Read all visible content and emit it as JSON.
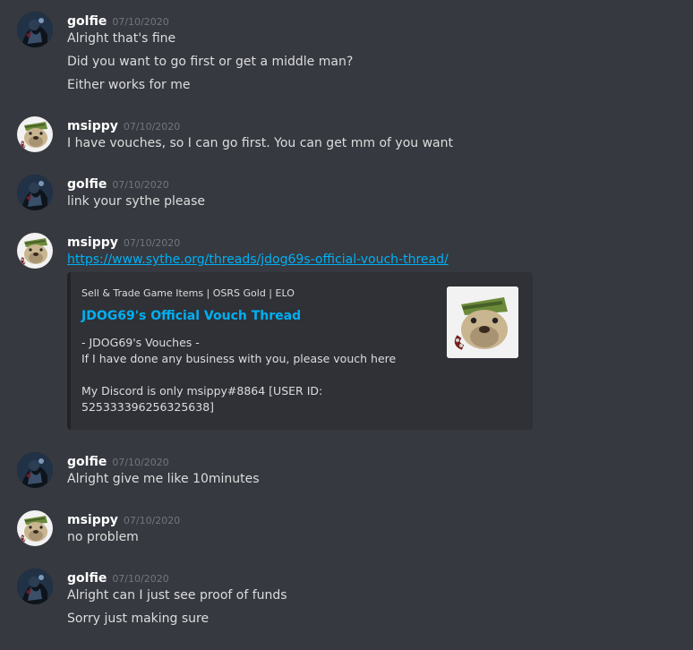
{
  "users": {
    "golfie": "golfie",
    "msippy": "msippy"
  },
  "messages": [
    {
      "author": "golfie",
      "timestamp": "07/10/2020",
      "lines": [
        "Alright that's fine",
        "Did you want to go first or get a middle man?",
        "Either works for me"
      ]
    },
    {
      "author": "msippy",
      "timestamp": "07/10/2020",
      "lines": [
        "I have vouches, so I can go first. You can get mm of you want"
      ]
    },
    {
      "author": "golfie",
      "timestamp": "07/10/2020",
      "lines": [
        "link your sythe please"
      ]
    },
    {
      "author": "msippy",
      "timestamp": "07/10/2020",
      "link": "https://www.sythe.org/threads/jdog69s-official-vouch-thread/",
      "embed": {
        "provider": "Sell & Trade Game Items | OSRS Gold | ELO",
        "title": "JDOG69's Official Vouch Thread",
        "description": [
          "- JDOG69's Vouches -",
          "If I have done any business with you, please vouch here",
          "",
          "My Discord is only msippy#8864 [USER ID:",
          "525333396256325638]"
        ]
      }
    },
    {
      "author": "golfie",
      "timestamp": "07/10/2020",
      "lines": [
        "Alright give me like 10minutes"
      ]
    },
    {
      "author": "msippy",
      "timestamp": "07/10/2020",
      "lines": [
        "no problem"
      ]
    },
    {
      "author": "golfie",
      "timestamp": "07/10/2020",
      "lines": [
        "Alright can I just see proof of funds",
        "Sorry just making sure"
      ]
    }
  ],
  "colors": {
    "background": "#36393f",
    "username": "#ffffff",
    "timestamp": "#72767d",
    "text": "#dcddde",
    "link": "#00b0f4",
    "embed_bg": "#2f3136"
  },
  "icons": {
    "golfie_avatar": "dark-character-avatar-icon",
    "msippy_avatar": "bulldog-avatar-icon",
    "embed_thumbnail": "bulldog-thumbnail-icon"
  }
}
